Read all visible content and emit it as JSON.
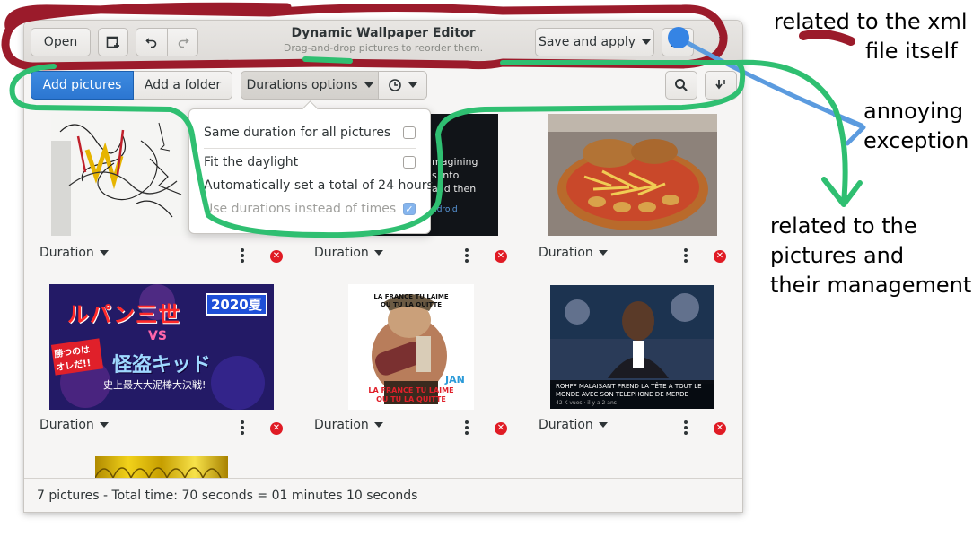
{
  "window": {
    "title": "Dynamic Wallpaper Editor",
    "subtitle": "Drag-and-drop pictures to reorder them."
  },
  "headerbar": {
    "open_label": "Open",
    "save_label": "Save and apply"
  },
  "toolbar": {
    "add_pictures_label": "Add pictures",
    "add_folder_label": "Add a folder",
    "durations_options_label": "Durations options"
  },
  "popover": {
    "items": [
      {
        "label": "Same duration for all pictures",
        "checked": false,
        "enabled": true
      },
      {
        "label": "Fit the daylight",
        "checked": false,
        "enabled": true
      },
      {
        "label": "Automatically set a total of 24 hours",
        "checked": null,
        "enabled": true
      },
      {
        "label": "Use durations instead of times",
        "checked": true,
        "enabled": false
      }
    ]
  },
  "pictures": [
    {
      "duration_label": "Duration"
    },
    {
      "duration_label": "Duration",
      "image_text": [
        "magining",
        "s into",
        "and then",
        "ndroid"
      ]
    },
    {
      "duration_label": "Duration"
    },
    {
      "duration_label": "Duration",
      "image_text": [
        "2020夏",
        "ルパン三世",
        "VS",
        "怪盗キッド",
        "史上最大大泥棒大決戦!",
        "勝つのは オレだ!!"
      ]
    },
    {
      "duration_label": "Duration",
      "image_text": [
        "LA FRANCE TU LAIME",
        "OU TU LA QUITTE",
        "LA FRANCE TU LAIME",
        "OU TU LA QUITTE",
        "JAN"
      ]
    },
    {
      "duration_label": "Duration",
      "image_text": [
        "ROHFF MALAISANT PREND LA TÊTE A TOUT LE",
        "MONDE AVEC SON TELEPHONE DE MERDE",
        "42 K vues · il y a 2 ans"
      ]
    }
  ],
  "statusbar": {
    "text": "7 pictures - Total time: 70 seconds = 01 minutes 10 seconds"
  },
  "annotations": {
    "xml": [
      "related to the xml",
      "file itself"
    ],
    "exception": [
      "annoying",
      "exception"
    ],
    "pictures": [
      "related to the",
      "pictures and",
      "their management"
    ]
  },
  "colors": {
    "accent_blue": "#3584e4",
    "delete_red": "#e01b24",
    "annotation_red": "#9b1b2b",
    "annotation_green": "#2fbf71",
    "annotation_blue": "#5b9bdf"
  }
}
